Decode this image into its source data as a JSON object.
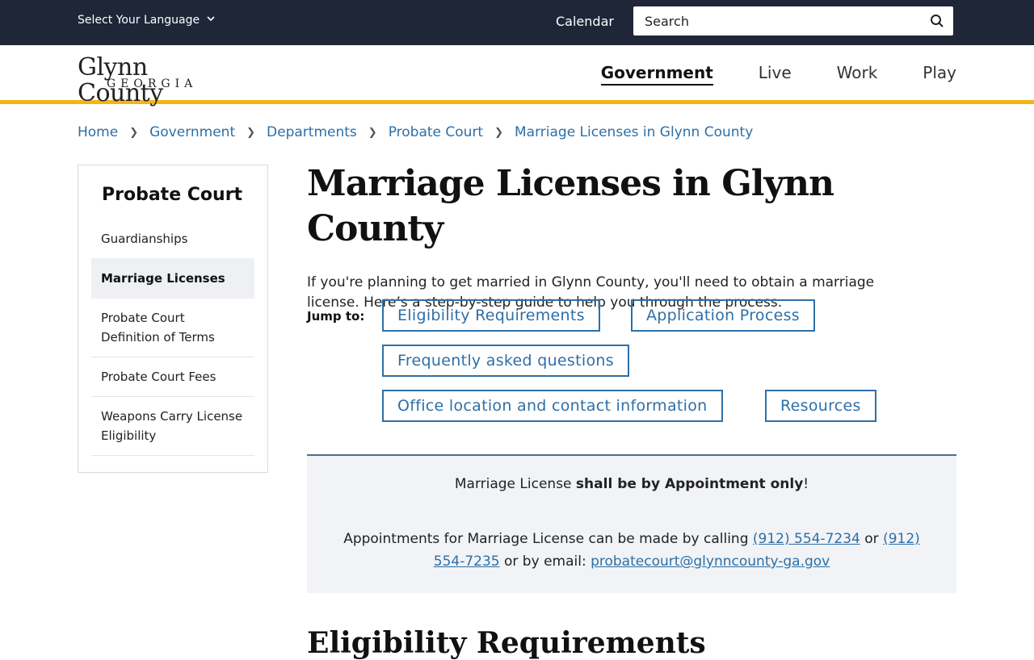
{
  "topbar": {
    "language_label": "Select Your Language",
    "calendar_label": "Calendar",
    "search_placeholder": "Search"
  },
  "logo": {
    "line1": "Glynn County",
    "line2": "GEORGIA"
  },
  "nav": {
    "items": [
      "Government",
      "Live",
      "Work",
      "Play"
    ],
    "active": "Government"
  },
  "breadcrumb": [
    "Home",
    "Government",
    "Departments",
    "Probate Court",
    "Marriage Licenses in Glynn County"
  ],
  "sidebar": {
    "title": "Probate Court",
    "items": [
      "Guardianships",
      "Marriage Licenses",
      "Probate Court Definition of Terms",
      "Probate Court Fees",
      "Weapons Carry License Eligibility"
    ],
    "current": "Marriage Licenses"
  },
  "main": {
    "title": "Marriage Licenses in Glynn County",
    "intro": "If you're planning to get married in Glynn County, you'll need to obtain a marriage license. Here’s a step-by-step guide to help you through the process.",
    "jump_label": "Jump to:",
    "jump_links": [
      "Eligibility Requirements",
      "Application Process",
      "Frequently asked questions",
      "Office location and contact information",
      "Resources"
    ],
    "notice": {
      "line1_pre": "Marriage License ",
      "line1_bold": "shall be by Appointment only",
      "line1_post": "!",
      "line2_pre": "Appointments for Marriage License can be made by calling ",
      "phone1": "(912) 554-7234",
      "or": " or ",
      "phone2": "(912) 554-7235",
      "email_pre": " or by email: ",
      "email": "probatecourt@glynncounty-ga.gov"
    },
    "next_heading": "Eligibility Requirements"
  },
  "colors": {
    "topbar": "#1e2638",
    "accent": "#f2b514",
    "link": "#2e6fa6"
  }
}
